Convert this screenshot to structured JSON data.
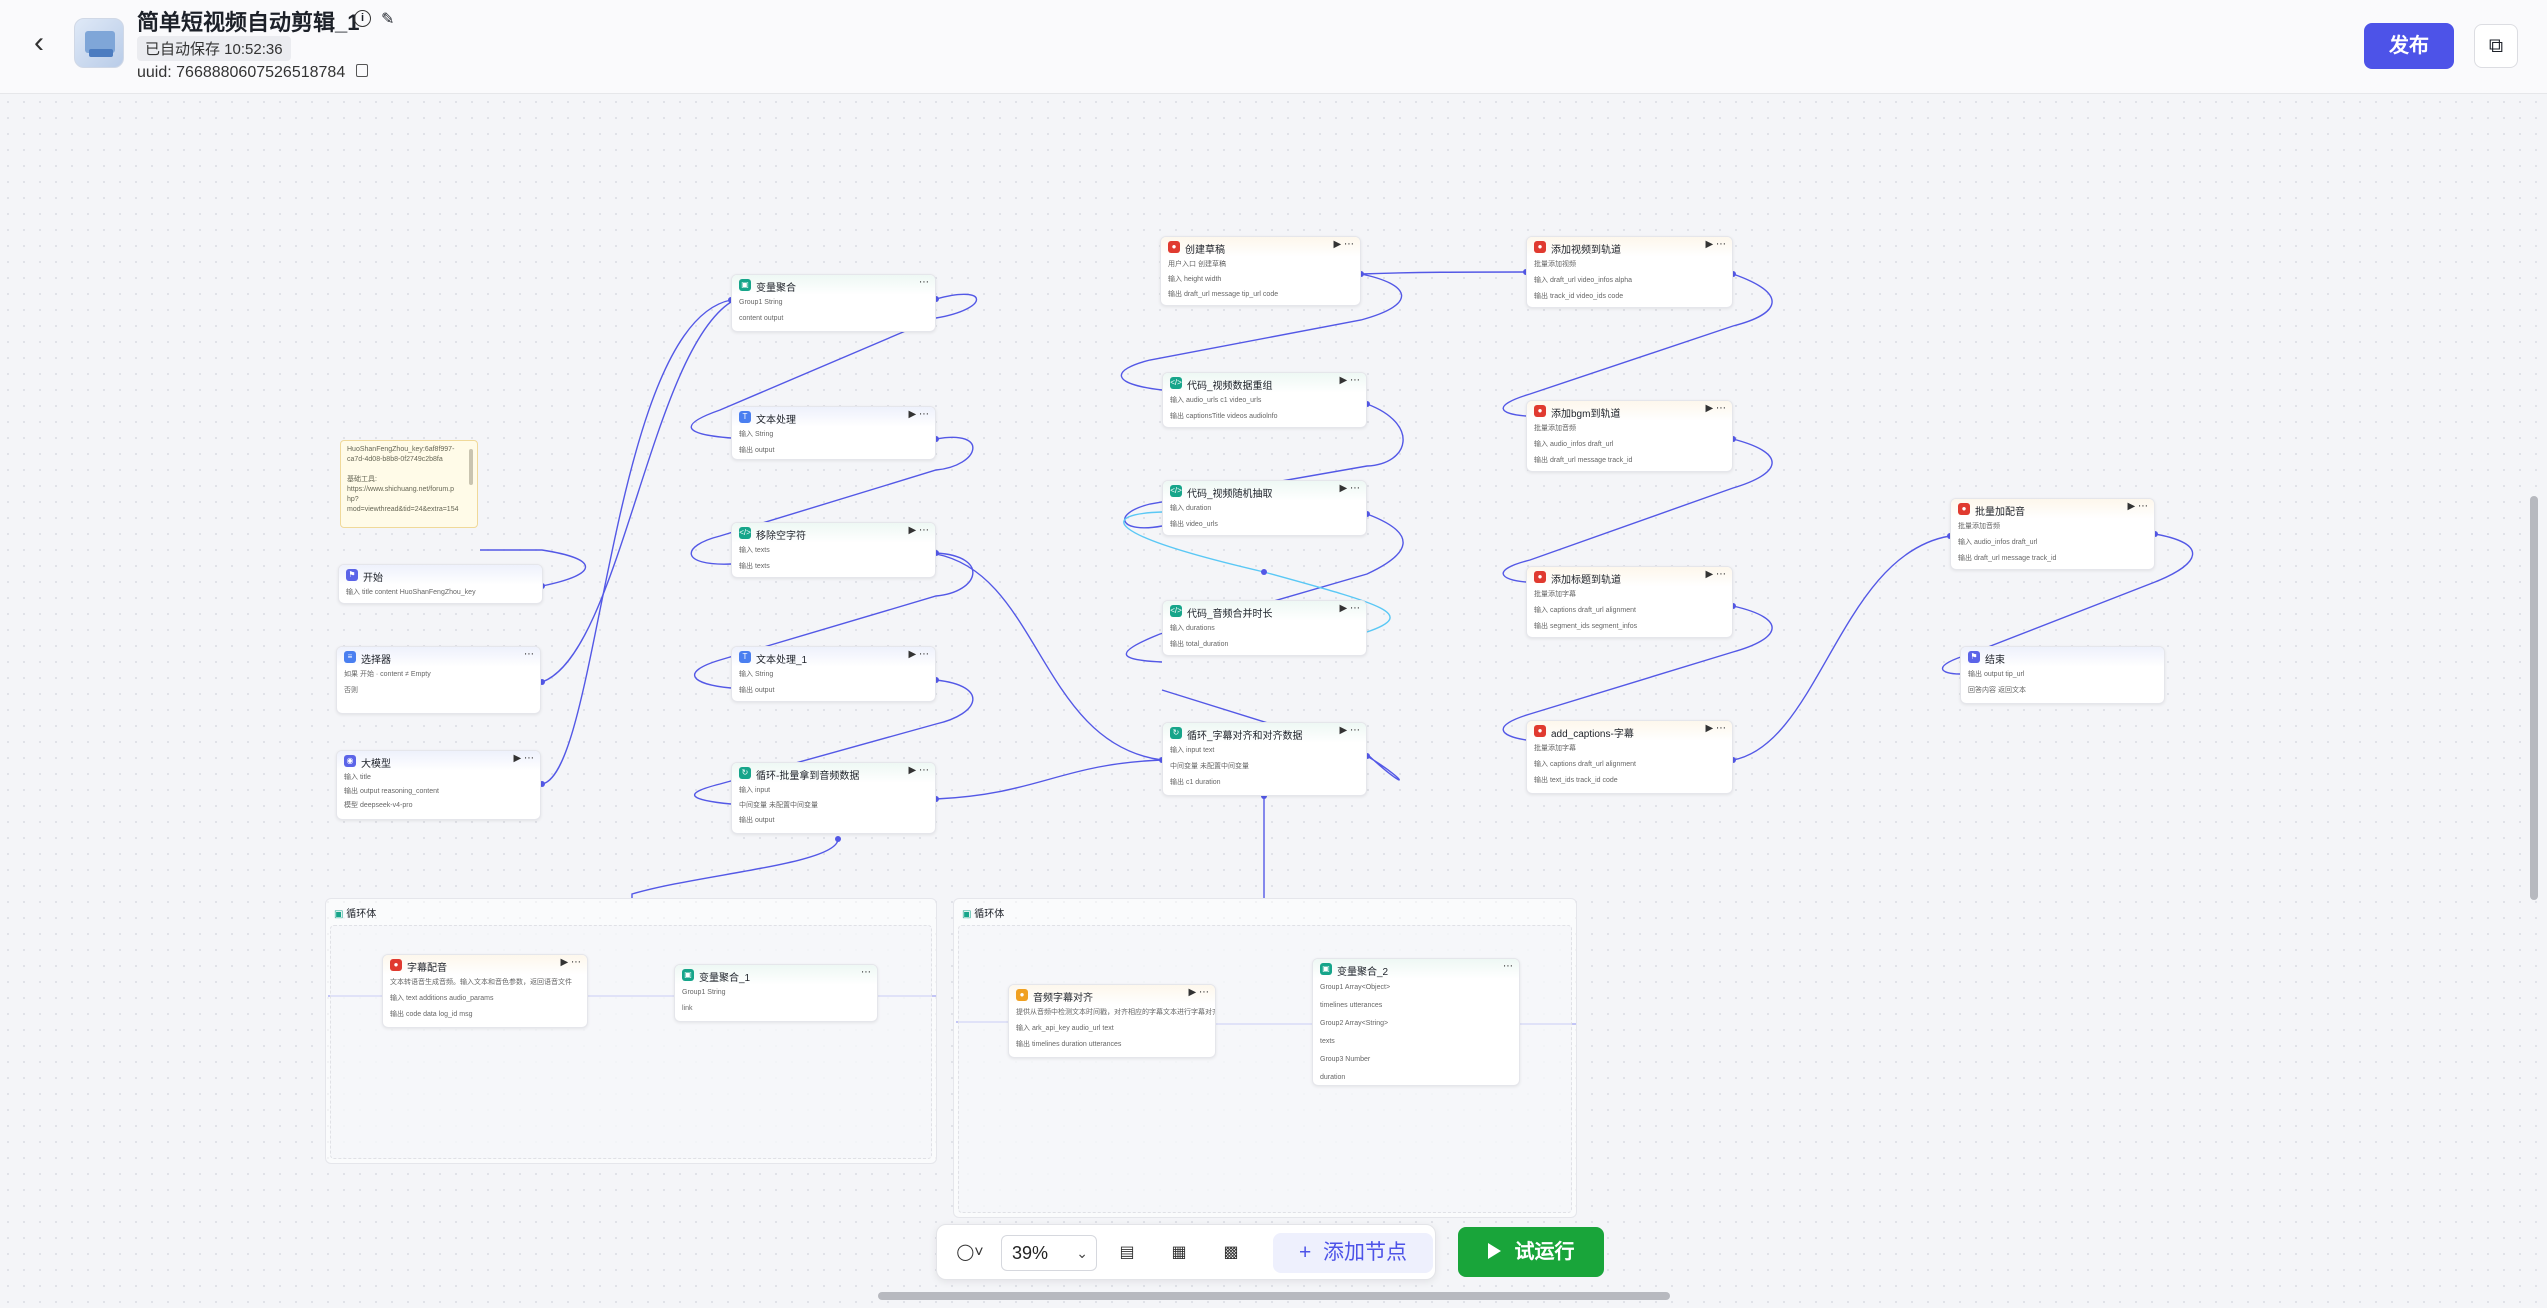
{
  "header": {
    "back_icon": "chevron-left-icon",
    "title": "简单短视频自动剪辑_1",
    "saved_status": "已自动保存 10:52:36",
    "uuid": "uuid: 7668880607526518784",
    "publish_label": "发布"
  },
  "note": {
    "lines": [
      "HuoShanFengZhou_key:6af8f997-",
      "ca7d-4d08-b8b8-0f2749c2b8fa",
      "",
      "基础工具:",
      "https://www.shichuang.net/forum.p",
      "hp?",
      "mod=viewthread&tid=24&extra=154"
    ]
  },
  "nodes": {
    "start": {
      "title": "开始",
      "row1": "输入   title   content   HuoShanFengZhou_key"
    },
    "selector": {
      "title": "选择器",
      "row1": "如果   开始 · content   ≠   Empty",
      "row2": "否则"
    },
    "llm": {
      "title": "大模型",
      "row1": "输入   title",
      "row2": "输出   output   reasoning_content",
      "row3": "模型   deepseek-v4-pro"
    },
    "var_agg": {
      "title": "变量聚合",
      "row1": "Group1   String",
      "row2": "content   output"
    },
    "text_proc": {
      "title": "文本处理",
      "row1": "输入   String",
      "row2": "输出   output"
    },
    "remove_char": {
      "title": "移除空字符",
      "row1": "输入   texts",
      "row2": "输出   texts"
    },
    "text_proc_1": {
      "title": "文本处理_1",
      "row1": "输入   String",
      "row2": "输出   output"
    },
    "loop_batch_subtitle": {
      "title": "循环-批量拿到音频数据",
      "row1": "输入   input",
      "row2": "中间变量  未配置中间变量",
      "row3": "输出   output"
    },
    "create_draft": {
      "title": "创建草稿",
      "row0": "用户入口 创建草稿",
      "row1": "输入   height   width",
      "row2": "输出   draft_url   message   tip_url   code"
    },
    "code_video": {
      "title": "代码_视频数据重组",
      "row1": "输入   audio_urls   c1   video_urls",
      "row2": "输出   captionsTitle   videos   audiolnfo"
    },
    "code_random": {
      "title": "代码_视频随机抽取",
      "row1": "输入   duration",
      "row2": "输出   video_urls"
    },
    "code_audio": {
      "title": "代码_音频合并时长",
      "row1": "输入   durations",
      "row2": "输出   total_duration"
    },
    "loop_align": {
      "title": "循环_字幕对齐和对齐数据",
      "row1": "输入   input   text",
      "row2": "中间变量  未配置中间变量",
      "row3": "输出   c1   duration"
    },
    "add_video_track": {
      "title": "添加视频到轨道",
      "row0": "批量添加视频",
      "row1": "输入   draft_url   video_infos   alpha",
      "row2": "输出   track_id   video_ids   code"
    },
    "add_bgm_track": {
      "title": "添加bgm到轨道",
      "row0": "批量添加音频",
      "row1": "输入   audio_infos   draft_url",
      "row2": "输出   draft_url   message   track_id"
    },
    "add_title_track": {
      "title": "添加标题到轨道",
      "row0": "批量添加字幕",
      "row1": "输入   captions   draft_url   alignment",
      "row2": "输出   segment_ids   segment_infos"
    },
    "add_captions": {
      "title": "add_captions-字幕",
      "row0": "批量添加字幕",
      "row1": "输入   captions   draft_url   alignment",
      "row2": "输出   text_ids   track_id   code"
    },
    "batch_dub": {
      "title": "批量加配音",
      "row0": "批量添加音频",
      "row1": "输入   audio_infos   draft_url",
      "row2": "输出   draft_url   message   track_id"
    },
    "end": {
      "title": "结束",
      "row1": "输出   output   tip_url",
      "row2": "回答内容   返回文本"
    },
    "subtitle_dub": {
      "title": "字幕配音",
      "row0": "文本转语音生成音频。输入文本和音色参数，返回语音文件",
      "row1": "输入   text   additions   audio_params",
      "row2": "输出   code   data   log_id   msg"
    },
    "var_agg_1": {
      "title": "变量聚合_1",
      "row1": "Group1   String",
      "row2": "link"
    },
    "audio_align": {
      "title": "音频字幕对齐",
      "row0": "提供从音频中检测文本时间戳，对齐相应的字幕文本进行字幕对齐",
      "row1": "输入   ark_api_key   audio_url   text",
      "row2": "输出   timelines   duration   utterances"
    },
    "var_agg_2": {
      "title": "变量聚合_2",
      "row1": "Group1   Array<Object>",
      "row2": "timelines   utterances",
      "row3": "Group2   Array<String>",
      "row4": "texts",
      "row5": "Group3   Number",
      "row6": "duration"
    }
  },
  "loops": {
    "loop1": {
      "title": "循环体"
    },
    "loop2": {
      "title": "循环体"
    }
  },
  "toolbar": {
    "mouse_icon": "mouse-icon",
    "zoom": "39%",
    "comment_icon": "comment-icon",
    "grid_icon": "layout-icon",
    "minimap_icon": "minimap-icon",
    "add_node_label": "添加节点",
    "run_label": "试运行"
  },
  "colors": {
    "accent": "#4d53e8",
    "edge": "#5358e6",
    "edge_active": "#5ac8f5",
    "run": "#19a53a"
  }
}
